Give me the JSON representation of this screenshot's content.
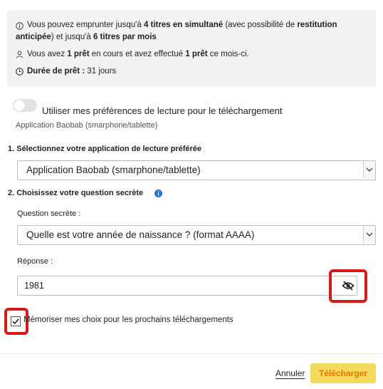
{
  "info": {
    "line1_a": "Vous pouvez emprunter jusqu'à ",
    "line1_b": "4 titres en simultané",
    "line1_c": " (avec possibilité de ",
    "line1_d": "restitution",
    "line2_a": "anticipée",
    "line2_b": ") et jusqu'à ",
    "line2_c": "6 titres par mois",
    "line3_a": "Vous avez ",
    "line3_b": "1 prêt",
    "line3_c": " en cours et avez effectué ",
    "line3_d": "1 prêt",
    "line3_e": " ce mois-ci.",
    "duration_label": "Durée de prêt :",
    "duration_value": " 31 jours"
  },
  "preferences": {
    "toggle_label": "Utiliser mes préférences de lecture pour le téléchargement",
    "app_caption": "Application Baobab (smarphone/tablette)"
  },
  "step1": {
    "title": "1. Sélectionnez votre application de lecture préférée",
    "selected": "Application Baobab (smarphone/tablette)"
  },
  "step2": {
    "title": "2. Choisissez votre question secrète",
    "question_label": "Question secrète :",
    "question_selected": "Quelle est votre année de naissance ? (format AAAA)",
    "answer_label": "Réponse :",
    "answer_value": "1981"
  },
  "remember": {
    "label": "Mémoriser mes choix pour les prochains téléchargements"
  },
  "actions": {
    "cancel": "Annuler",
    "download": "Télécharger"
  },
  "colors": {
    "highlight_box": "#d61a1a",
    "download_bg": "#f3da5b",
    "download_text": "#e07a00",
    "info_icon": "#2f6fce"
  },
  "icons": [
    "info-circle-icon",
    "user-icon",
    "clock-icon",
    "eye-slash-icon",
    "chevron-down-icon",
    "checkmark-icon"
  ]
}
